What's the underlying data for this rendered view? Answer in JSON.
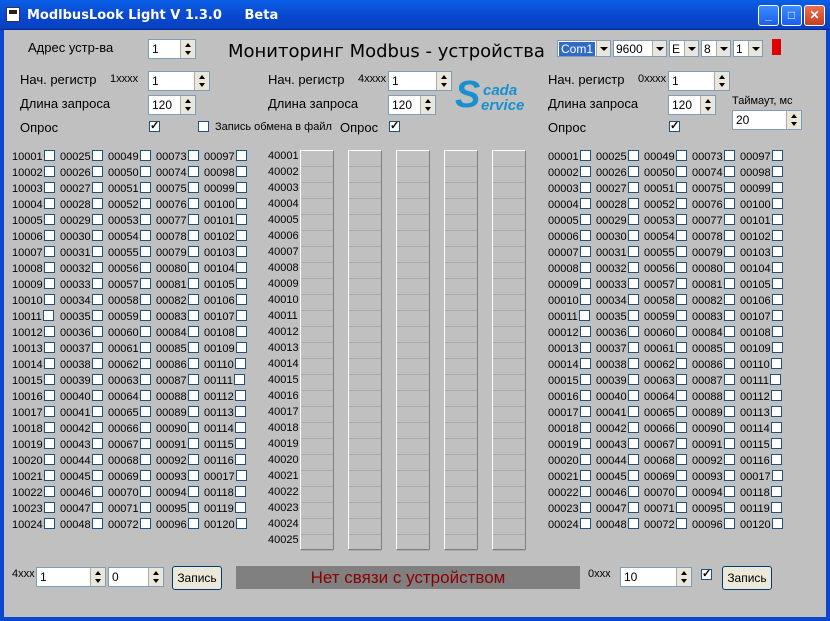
{
  "window": {
    "title": "ModlbusLook Light V 1.3.0     Beta",
    "min": "_",
    "max": "□",
    "close": "✕"
  },
  "header": {
    "title": "Мониторинг Modbus - устройства"
  },
  "device": {
    "addr_label": "Адрес устр-ва",
    "addr_value": "1"
  },
  "comm": {
    "port": "Com1",
    "baud": "9600",
    "parity": "E",
    "databits": "8",
    "stopbits": "1"
  },
  "block1": {
    "start_label": "Нач. регистр",
    "start_prefix": "1xxxx",
    "start_value": "1",
    "len_label": "Длина запроса",
    "len_value": "120",
    "poll_label": "Опрос"
  },
  "block4": {
    "start_label": "Нач. регистр",
    "start_prefix": "4xxxx",
    "start_value": "1",
    "len_label": "Длина запроса",
    "len_value": "120",
    "poll_label": "Опрос",
    "log_label": "Запись обмена в файл"
  },
  "block0": {
    "start_label": "Нач. регистр",
    "start_prefix": "0xxxx",
    "start_value": "1",
    "len_label": "Длина запроса",
    "len_value": "120",
    "poll_label": "Опрос"
  },
  "timeout": {
    "label": "Таймаут, мс",
    "value": "20"
  },
  "logo": {
    "s": "S",
    "top": "cada",
    "bottom": "ervice"
  },
  "inputs_1x": {
    "columns": [
      [
        "10001",
        "10002",
        "10003",
        "10004",
        "10005",
        "10006",
        "10007",
        "10008",
        "10009",
        "10010",
        "10011",
        "10012",
        "10013",
        "10014",
        "10015",
        "10016",
        "10017",
        "10018",
        "10019",
        "10020",
        "10021",
        "10022",
        "10023",
        "10024"
      ],
      [
        "00025",
        "00026",
        "00027",
        "00028",
        "00029",
        "00030",
        "00031",
        "00032",
        "00033",
        "00034",
        "00035",
        "00036",
        "00037",
        "00038",
        "00039",
        "00040",
        "00041",
        "00042",
        "00043",
        "00044",
        "00045",
        "00046",
        "00047",
        "00048"
      ],
      [
        "00049",
        "00050",
        "00051",
        "00052",
        "00053",
        "00054",
        "00055",
        "00056",
        "00057",
        "00058",
        "00059",
        "00060",
        "00061",
        "00062",
        "00063",
        "00064",
        "00065",
        "00066",
        "00067",
        "00068",
        "00069",
        "00070",
        "00071",
        "00072"
      ],
      [
        "00073",
        "00074",
        "00075",
        "00076",
        "00077",
        "00078",
        "00079",
        "00080",
        "00081",
        "00082",
        "00083",
        "00084",
        "00085",
        "00086",
        "00087",
        "00088",
        "00089",
        "00090",
        "00091",
        "00092",
        "00093",
        "00094",
        "00095",
        "00096"
      ],
      [
        "00097",
        "00098",
        "00099",
        "00100",
        "00101",
        "00102",
        "00103",
        "00104",
        "00105",
        "00106",
        "00107",
        "00108",
        "00109",
        "00110",
        "00111",
        "00112",
        "00113",
        "00114",
        "00115",
        "00116",
        "00017",
        "00118",
        "00119",
        "00120"
      ]
    ]
  },
  "coils_0x": {
    "columns": [
      [
        "00001",
        "00002",
        "00003",
        "00004",
        "00005",
        "00006",
        "00007",
        "00008",
        "00009",
        "00010",
        "00011",
        "00012",
        "00013",
        "00014",
        "00015",
        "00016",
        "00017",
        "00018",
        "00019",
        "00020",
        "00021",
        "00022",
        "00023",
        "00024"
      ],
      [
        "00025",
        "00026",
        "00027",
        "00028",
        "00029",
        "00030",
        "00031",
        "00032",
        "00033",
        "00034",
        "00035",
        "00036",
        "00037",
        "00038",
        "00039",
        "00040",
        "00041",
        "00042",
        "00043",
        "00044",
        "00045",
        "00046",
        "00047",
        "00048"
      ],
      [
        "00049",
        "00050",
        "00051",
        "00052",
        "00053",
        "00054",
        "00055",
        "00056",
        "00057",
        "00058",
        "00059",
        "00060",
        "00061",
        "00062",
        "00063",
        "00064",
        "00065",
        "00066",
        "00067",
        "00068",
        "00069",
        "00070",
        "00071",
        "00072"
      ],
      [
        "00073",
        "00074",
        "00075",
        "00076",
        "00077",
        "00078",
        "00079",
        "00080",
        "00081",
        "00082",
        "00083",
        "00084",
        "00085",
        "00086",
        "00087",
        "00088",
        "00089",
        "00090",
        "00091",
        "00092",
        "00093",
        "00094",
        "00095",
        "00096"
      ],
      [
        "00097",
        "00098",
        "00099",
        "00100",
        "00101",
        "00102",
        "00103",
        "00104",
        "00105",
        "00106",
        "00107",
        "00108",
        "00109",
        "00110",
        "00111",
        "00112",
        "00113",
        "00114",
        "00115",
        "00116",
        "00017",
        "00118",
        "00119",
        "00120"
      ]
    ]
  },
  "registers_4x": [
    "40001",
    "40002",
    "40003",
    "40004",
    "40005",
    "40006",
    "40007",
    "40008",
    "40009",
    "40010",
    "40011",
    "40012",
    "40013",
    "40014",
    "40015",
    "40016",
    "40017",
    "40018",
    "40019",
    "40020",
    "40021",
    "40022",
    "40023",
    "40024",
    "40025"
  ],
  "bottom": {
    "w4_prefix": "4xxx",
    "w4_addr": "1",
    "w4_value": "0",
    "write_label": "Запись",
    "status": "Нет связи с устройством",
    "w0_prefix": "0xxx",
    "w0_addr": "10",
    "write0_label": "Запись"
  }
}
